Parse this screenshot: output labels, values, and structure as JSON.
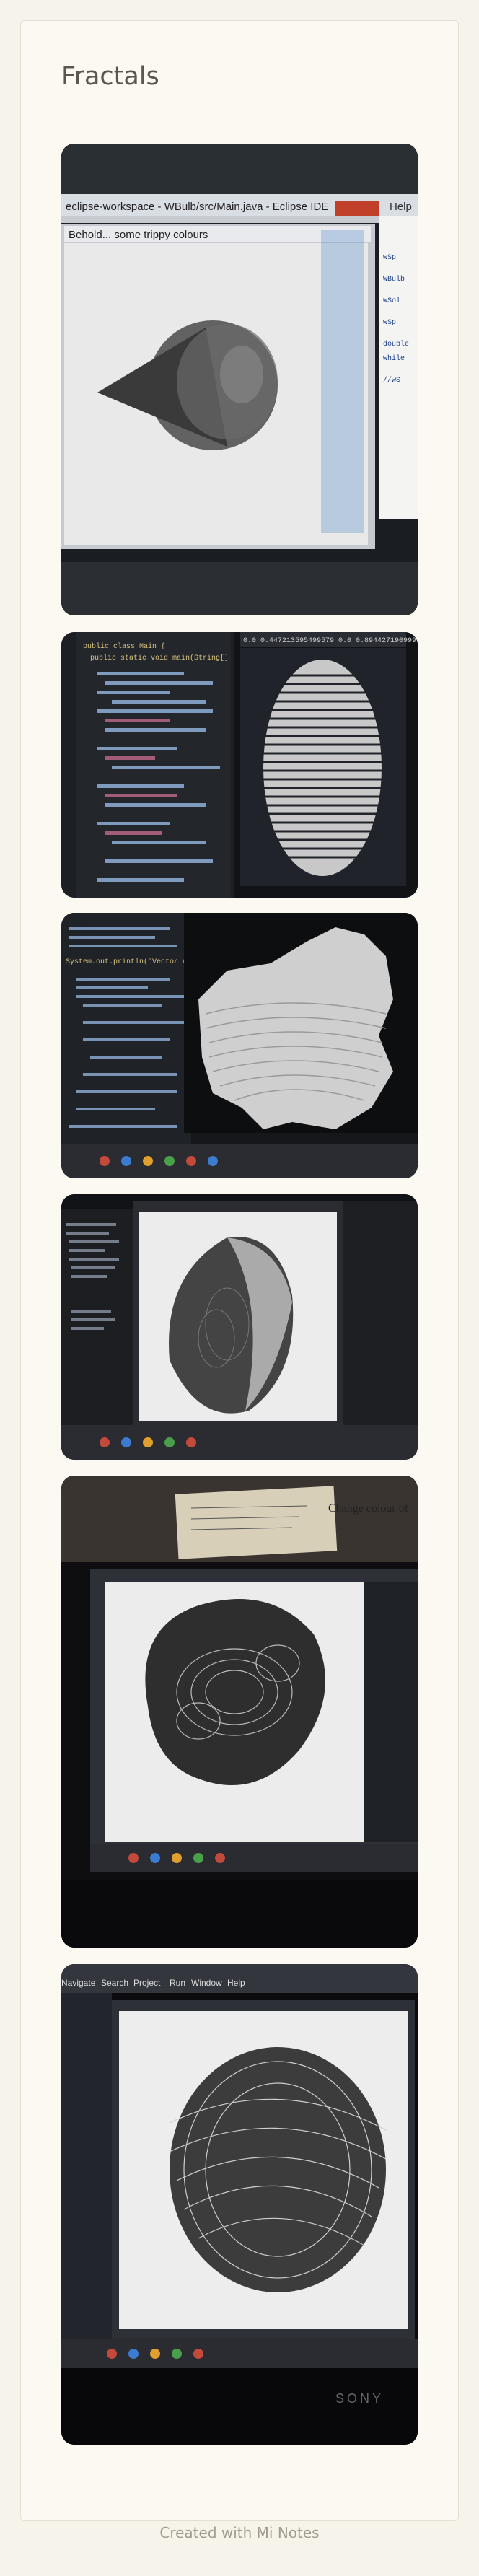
{
  "note": {
    "title": "Fractals",
    "footer": "Created with Mi Notes"
  },
  "photos": [
    {
      "eclipse_title": "eclipse-workspace - WBulb/src/Main.java - Eclipse IDE",
      "window_title": "Behold... some trippy colours",
      "menu_hint": "Help",
      "code_lines": [
        "WBulb",
        "wSol",
        "double",
        "while",
        "wSp",
        "wSp",
        "//wS"
      ]
    },
    {
      "class_decl": "public class Main {",
      "main_decl": "public static void main(String[]",
      "header_text": "0.0 0.447213595499579 0.0 0.894427190999916"
    },
    {
      "code_hint": "System.out.println(\"Vector diver"
    },
    {},
    {
      "sticky_note": "Change colour of"
    },
    {
      "menu_items": [
        "Navigate",
        "Search",
        "Project",
        "Run",
        "Window",
        "Help"
      ],
      "brand": "SONY"
    }
  ],
  "colors": {
    "background": "#f6f3ea",
    "title": "#5b5650",
    "footer": "#a09a90"
  }
}
